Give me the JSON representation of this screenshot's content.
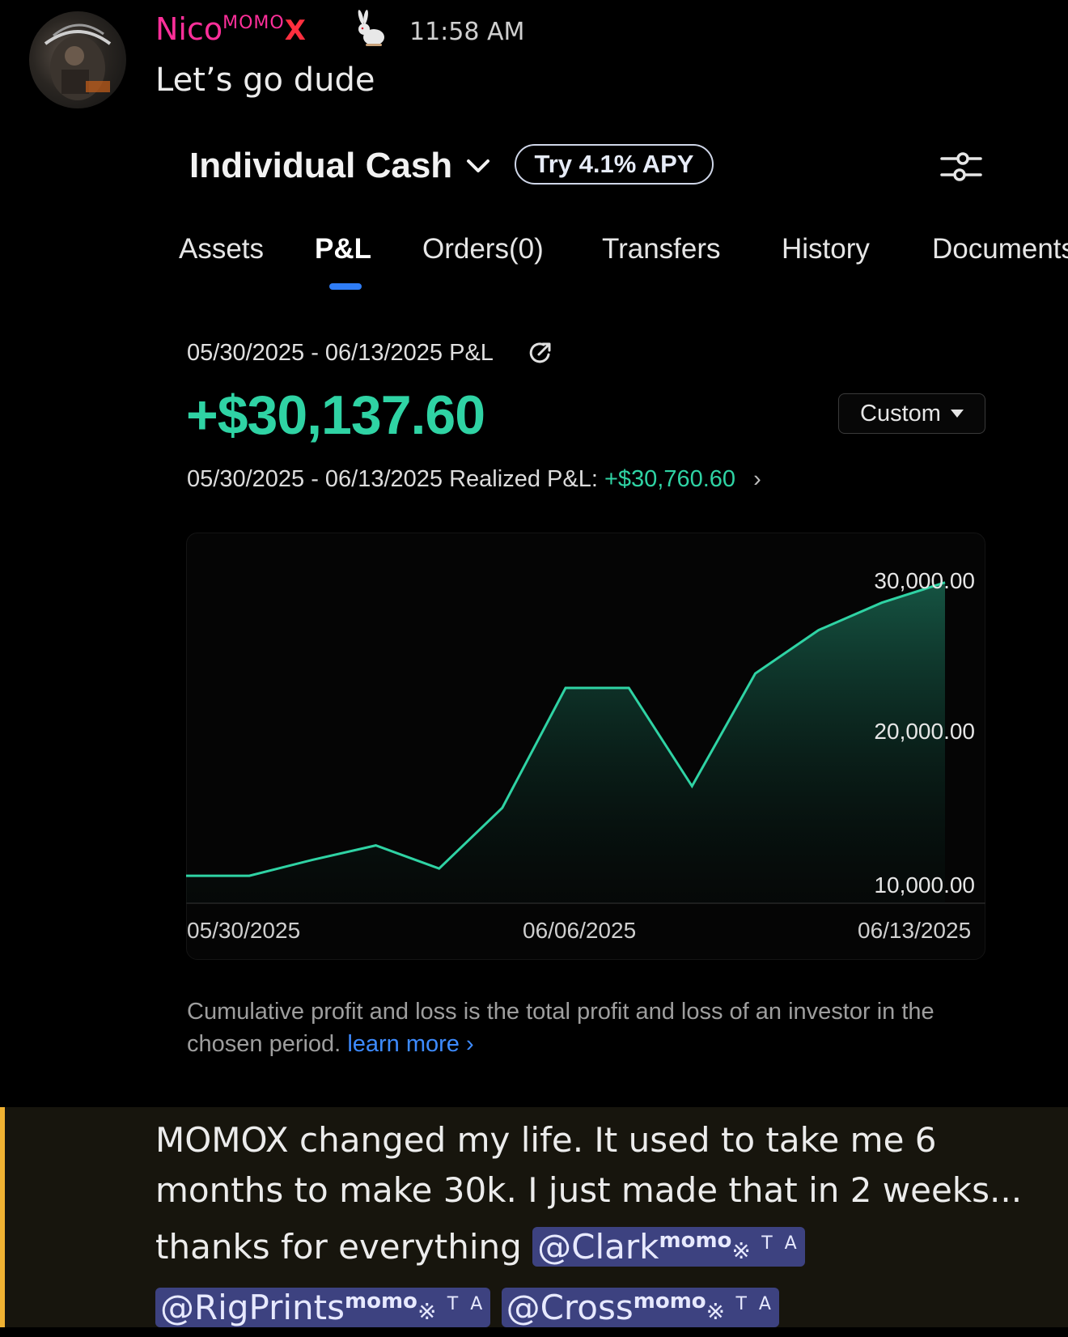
{
  "message_header": {
    "username": "Nico",
    "role_tag": "MOMO",
    "role_mark": "X",
    "badge_icon": "rabbit-icon",
    "timestamp": "11:58 AM"
  },
  "message_text": "Let’s go dude",
  "account": {
    "title": "Individual Cash",
    "apy_button": "Try 4.1% APY",
    "settings_icon": "sliders-icon"
  },
  "tabs": [
    {
      "label": "Assets",
      "active": false
    },
    {
      "label": "P&L",
      "active": true
    },
    {
      "label": "Orders(0)",
      "active": false
    },
    {
      "label": "Transfers",
      "active": false
    },
    {
      "label": "History",
      "active": false
    },
    {
      "label": "Documents",
      "active": false
    }
  ],
  "pnl": {
    "range_label": "05/30/2025 - 06/13/2025 P&L",
    "value": "+$30,137.60",
    "period_selector": "Custom",
    "realized_label": "05/30/2025 - 06/13/2025 Realized P&L:",
    "realized_value": "+$30,760.60"
  },
  "colors": {
    "accent_green": "#2fd3a4",
    "link_blue": "#3d8bff",
    "tab_indicator": "#2f7df6",
    "username_pink": "#ff2f9a",
    "mention_bg": "#3d4280",
    "highlight_bar": "#f0b232"
  },
  "chart_data": {
    "type": "area",
    "x": [
      "05/30/2025",
      "05/31/2025",
      "06/01/2025",
      "06/02/2025",
      "06/03/2025",
      "06/04/2025",
      "06/05/2025",
      "06/06/2025",
      "06/07/2025",
      "06/08/2025",
      "06/09/2025",
      "06/10/2025",
      "06/11/2025",
      "06/12/2025",
      "06/13/2025"
    ],
    "series": [
      {
        "values": [
          9800,
          9800,
          10900,
          11900,
          10300,
          14500,
          22800,
          22800,
          16000,
          23800,
          26800,
          28700,
          30100
        ]
      }
    ],
    "x_ticks": [
      "05/30/2025",
      "06/06/2025",
      "06/13/2025"
    ],
    "y_ticks": [
      "10,000.00",
      "20,000.00",
      "30,000.00"
    ],
    "ylim": [
      7900,
      32100
    ],
    "grid": false,
    "legend": "none"
  },
  "footnote": {
    "text": "Cumulative profit and loss is the total profit and loss of an investor in the chosen period.",
    "link": "learn more"
  },
  "highlight_message": {
    "text": "MOMOX changed my life. It used to take me 6 months to make 30k. I just made that in 2 weeks... thanks for everything",
    "mentions": [
      {
        "name": "@Clark",
        "tag": "momo",
        "mark": "※",
        "suffix": "T A"
      },
      {
        "name": "@RigPrints",
        "tag": "momo",
        "mark": "※",
        "suffix": "T A"
      },
      {
        "name": "@Cross",
        "tag": "momo",
        "mark": "※",
        "suffix": "T A"
      }
    ]
  }
}
